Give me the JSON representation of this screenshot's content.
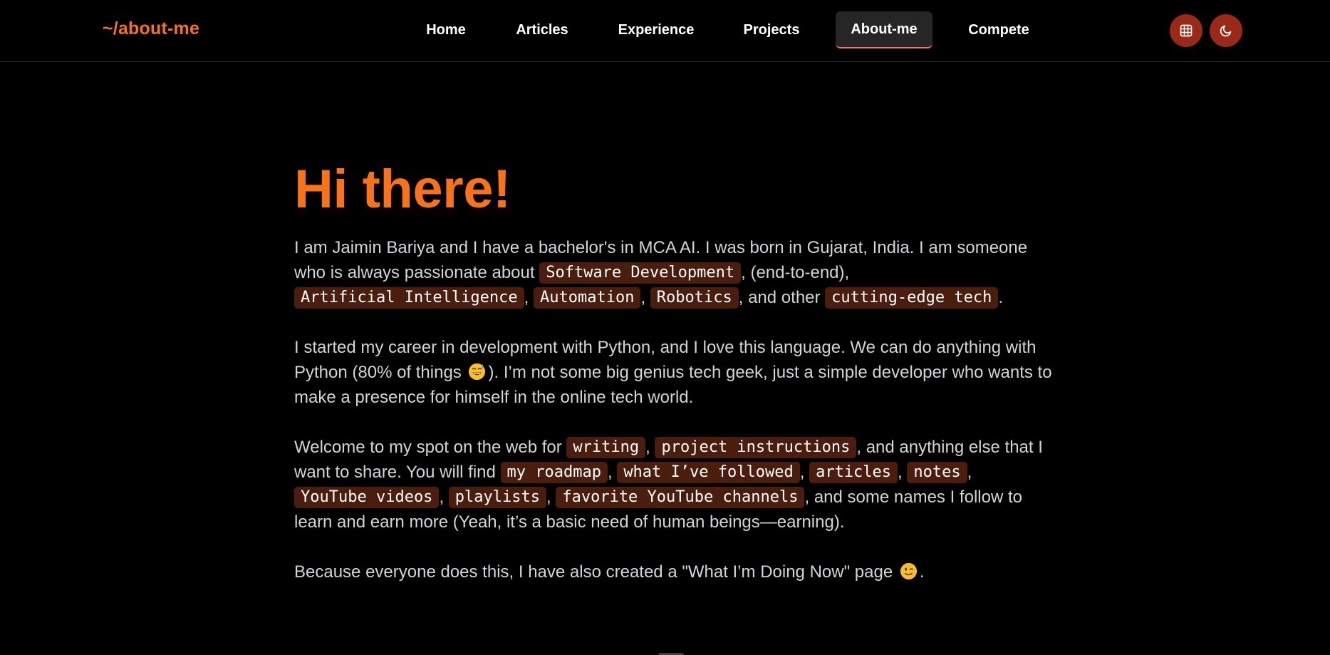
{
  "header": {
    "logo": "~/about-me",
    "nav": [
      {
        "label": "Home",
        "active": false
      },
      {
        "label": "Articles",
        "active": false
      },
      {
        "label": "Experience",
        "active": false
      },
      {
        "label": "Projects",
        "active": false
      },
      {
        "label": "About-me",
        "active": true
      },
      {
        "label": "Compete",
        "active": false
      }
    ],
    "buttons": [
      {
        "icon": "grid-icon"
      },
      {
        "icon": "moon-icon"
      }
    ]
  },
  "main": {
    "title": "Hi there!",
    "p1": {
      "t1": "I am Jaimin Bariya and I have a bachelor's in MCA AI. I was born in Gujarat, India. I am someone who is always passionate about ",
      "tag1": "Software Development",
      "t2": ", (end-to-end), ",
      "tag2": "Artificial Intelligence",
      "t3": ", ",
      "tag3": "Automation",
      "t4": ", ",
      "tag4": "Robotics",
      "t5": ", and other ",
      "tag5": "cutting-edge tech",
      "t6": "."
    },
    "p2": {
      "t1": "I started my career in development with Python, and I love this language. We can do anything with Python (80% of things ",
      "t2": "). I’m not some big genius tech geek, just a simple developer who wants to make a presence for himself in the online tech world."
    },
    "p3": {
      "t1": "Welcome to my spot on the web for ",
      "tag1": "writing",
      "t2": ", ",
      "tag2": "project instructions",
      "t3": ", and anything else that I want to share. You will find ",
      "tag3": "my roadmap",
      "t4": ", ",
      "tag4": "what I’ve followed",
      "t5": ", ",
      "tag5": "articles",
      "t6": ", ",
      "tag6": "notes",
      "t7": ", ",
      "tag7": "YouTube videos",
      "t8": ", ",
      "tag8": "playlists",
      "t9": ", ",
      "tag9": "favorite YouTube channels",
      "t10": ", and some names I follow to learn and earn more (Yeah, it’s a basic need of human beings—earning)."
    },
    "p4": {
      "t1": "Because everyone does this, I have also created a \"What I’m Doing Now\" page ",
      "t2": "."
    }
  },
  "colors": {
    "accent": "#f97316",
    "tag_bg": "#4a1d0d",
    "button_bg": "#9a2a17",
    "active_underline": "#f87171"
  }
}
